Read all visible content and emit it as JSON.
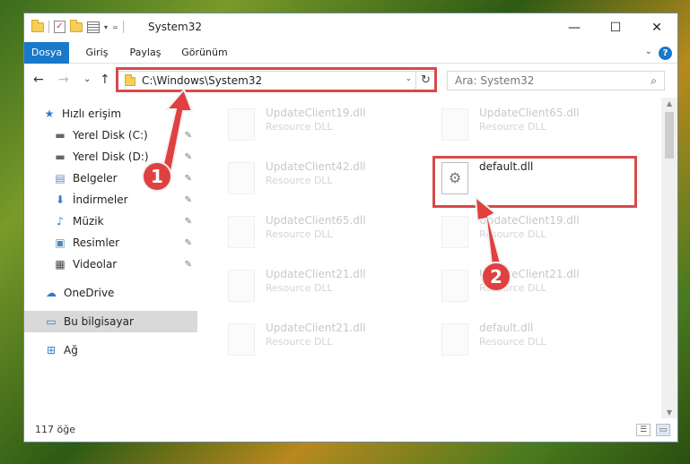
{
  "window": {
    "title": "System32",
    "controls": {
      "minimize": "—",
      "maximize": "☐",
      "close": "✕"
    }
  },
  "quick_access_toolbar": {
    "dropdown": "▾",
    "customize": "="
  },
  "ribbon": {
    "tabs": [
      "Dosya",
      "Giriş",
      "Paylaş",
      "Görünüm"
    ],
    "expand": "⌄",
    "help": "?"
  },
  "nav": {
    "back": "←",
    "forward": "→",
    "recent": "⌄",
    "up": "↑"
  },
  "address": {
    "path": "C:\\Windows\\System32",
    "dropdown": "⌄",
    "refresh": "↻"
  },
  "search": {
    "placeholder": "Ara: System32",
    "icon": "⌕"
  },
  "sidebar": {
    "items": [
      {
        "label": "Hızlı erişim",
        "icon": "star-icon",
        "glyph": "★",
        "pinned": false
      },
      {
        "label": "Yerel Disk (C:)",
        "icon": "drive-icon",
        "glyph": "▬",
        "pinned": true
      },
      {
        "label": "Yerel Disk (D:)",
        "icon": "drive-icon",
        "glyph": "▬",
        "pinned": true
      },
      {
        "label": "Belgeler",
        "icon": "documents-icon",
        "glyph": "▤",
        "pinned": true
      },
      {
        "label": "İndirmeler",
        "icon": "download-icon",
        "glyph": "⬇",
        "pinned": true
      },
      {
        "label": "Müzik",
        "icon": "music-icon",
        "glyph": "♪",
        "pinned": true
      },
      {
        "label": "Resimler",
        "icon": "pictures-icon",
        "glyph": "▣",
        "pinned": true
      },
      {
        "label": "Videolar",
        "icon": "videos-icon",
        "glyph": "▦",
        "pinned": true
      },
      {
        "label": "OneDrive",
        "icon": "cloud-icon",
        "glyph": "☁",
        "pinned": false
      },
      {
        "label": "Bu bilgisayar",
        "icon": "computer-icon",
        "glyph": "▭",
        "pinned": false,
        "selected": true
      },
      {
        "label": "Ağ",
        "icon": "network-icon",
        "glyph": "⊞",
        "pinned": false
      }
    ],
    "pin_glyph": "✎"
  },
  "files": [
    {
      "name": "UpdateClient19.dll",
      "desc": "Resource DLL"
    },
    {
      "name": "UpdateClient65.dll",
      "desc": "Resource DLL"
    },
    {
      "name": "UpdateClient42.dll",
      "desc": "Resource DLL"
    },
    {
      "name": "default.dll",
      "desc": "",
      "highlight": true
    },
    {
      "name": "UpdateClient65.dll",
      "desc": "Resource DLL"
    },
    {
      "name": "UpdateClient19.dll",
      "desc": "Resource DLL"
    },
    {
      "name": "UpdateClient21.dll",
      "desc": "Resource DLL"
    },
    {
      "name": "UpdateClient21.dll",
      "desc": "Resource DLL"
    },
    {
      "name": "UpdateClient21.dll",
      "desc": "Resource DLL"
    },
    {
      "name": "default.dll",
      "desc": "Resource DLL"
    }
  ],
  "status": {
    "count": "117 öğe"
  },
  "annotations": {
    "badge1": "1",
    "badge2": "2",
    "color": "#d64a4a"
  }
}
